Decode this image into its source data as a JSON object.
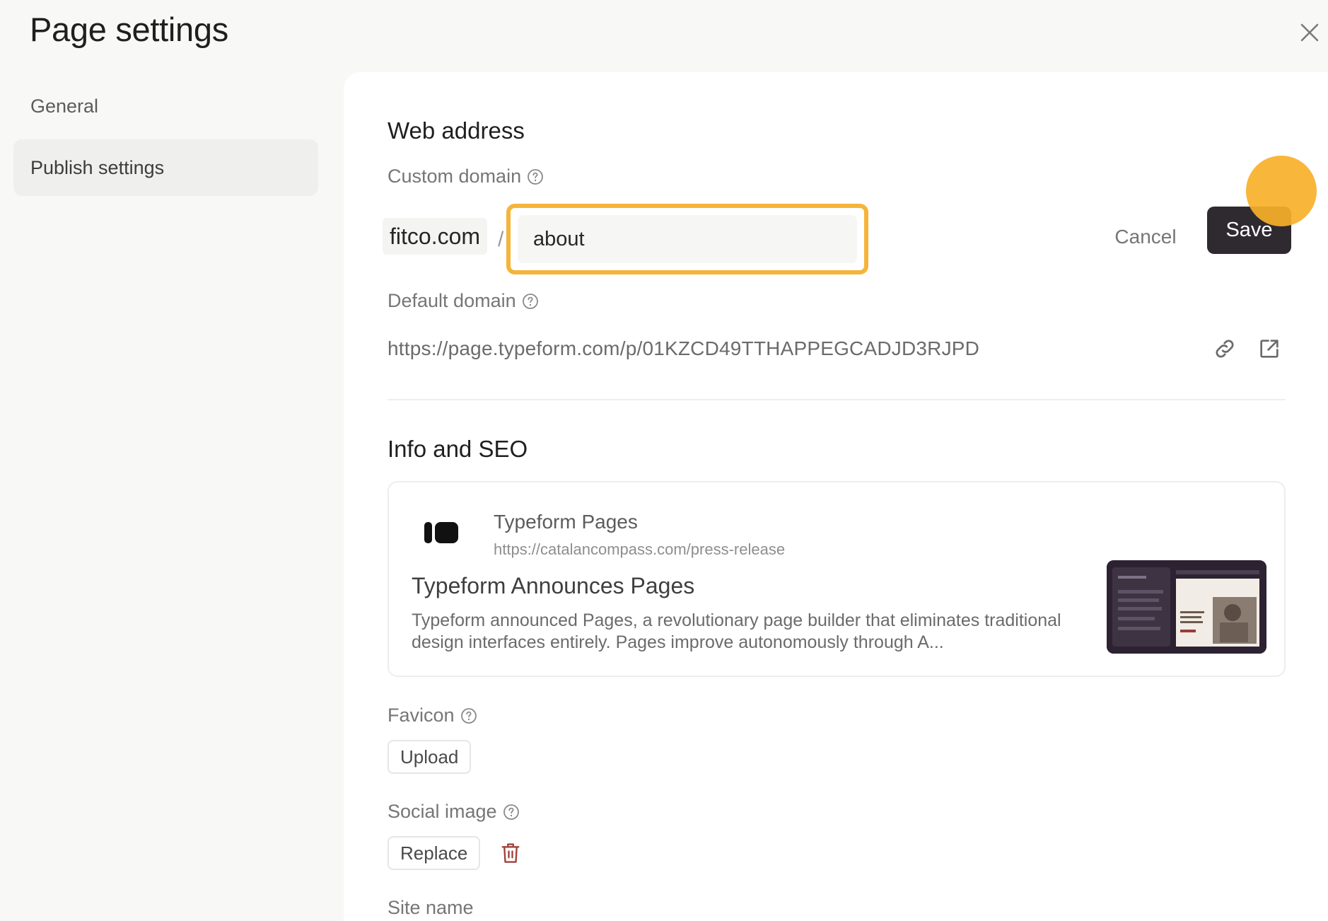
{
  "header": {
    "title": "Page settings",
    "close_icon": "close-icon"
  },
  "sidebar": {
    "items": [
      {
        "label": "General",
        "active": false
      },
      {
        "label": "Publish settings",
        "active": true
      }
    ]
  },
  "web_address": {
    "heading": "Web address",
    "custom_domain": {
      "label": "Custom domain",
      "prefix": "fitco.com",
      "separator": "/",
      "value": "about",
      "highlight_color": "#f5b43a"
    },
    "actions": {
      "cancel_label": "Cancel",
      "save_label": "Save"
    },
    "default_domain": {
      "label": "Default domain",
      "url": "https://page.typeform.com/p/01KZCD49TTHAPPEGCADJD3RJPD",
      "icons": [
        "link-icon",
        "external-link-icon"
      ]
    }
  },
  "info_seo": {
    "heading": "Info and SEO",
    "preview": {
      "site_name": "Typeform Pages",
      "url": "https://catalancompass.com/press-release",
      "title": "Typeform Announces Pages",
      "description": "Typeform announced Pages, a revolutionary page builder that eliminates traditional design interfaces entirely. Pages improve autonomously through A..."
    },
    "favicon": {
      "label": "Favicon",
      "button_label": "Upload"
    },
    "social_image": {
      "label": "Social image",
      "button_label": "Replace",
      "delete_icon": "trash-icon",
      "delete_color": "#a0423c"
    },
    "site_name_label": "Site name"
  },
  "colors": {
    "accent": "#f5b43a",
    "primary_button": "#2f2a30"
  }
}
